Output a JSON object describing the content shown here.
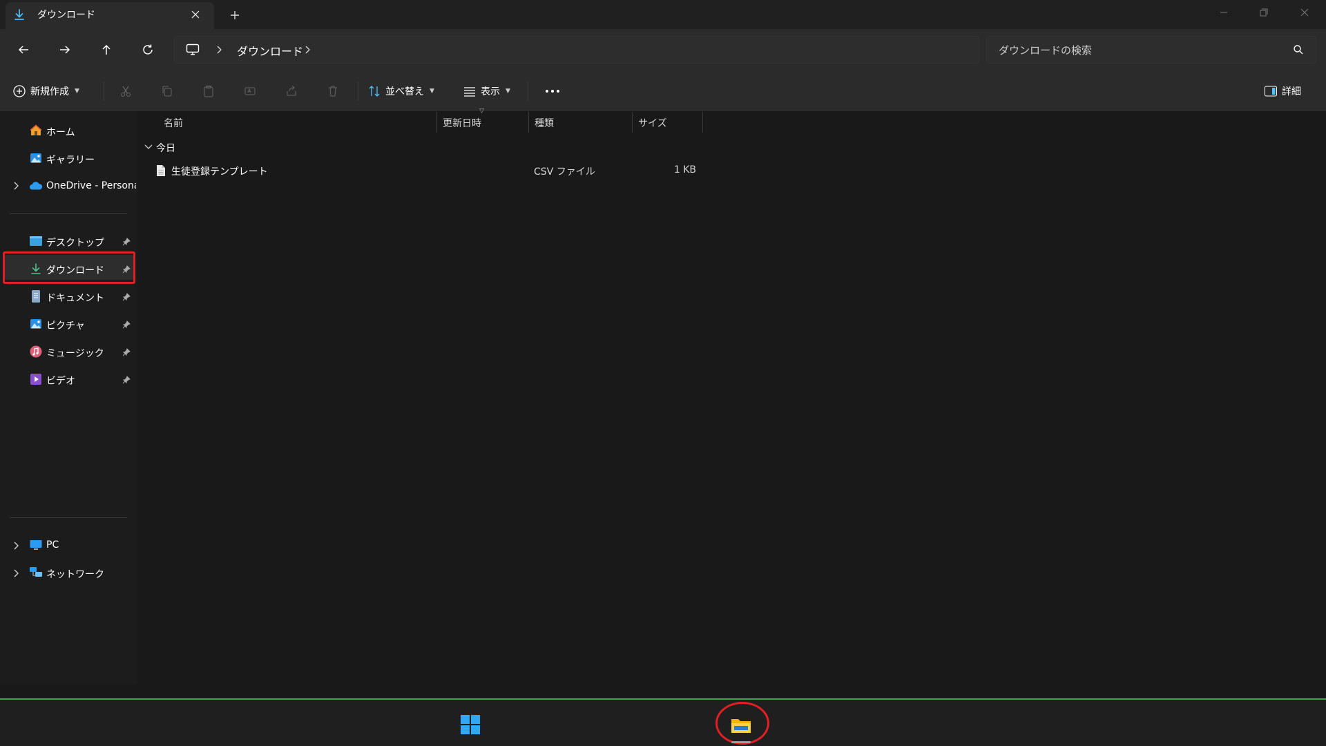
{
  "window": {
    "tab_title": "ダウンロード",
    "colors": {
      "accent": "#0078d4",
      "highlight": "#e21f24",
      "taskbar_line": "#3aa84a"
    }
  },
  "address": {
    "breadcrumb": [
      "ダウンロード"
    ],
    "search_placeholder": "ダウンロードの検索"
  },
  "toolbar": {
    "new_label": "新規作成",
    "sort_label": "並べ替え",
    "view_label": "表示",
    "details_label": "詳細"
  },
  "sidebar": {
    "top_items": [
      {
        "label": "ホーム",
        "icon": "home-icon"
      },
      {
        "label": "ギャラリー",
        "icon": "gallery-icon"
      },
      {
        "label": "OneDrive - Persona",
        "icon": "onedrive-icon"
      }
    ],
    "pinned_items": [
      {
        "label": "デスクトップ",
        "icon": "desktop-folder-icon"
      },
      {
        "label": "ダウンロード",
        "icon": "download-icon",
        "selected": true
      },
      {
        "label": "ドキュメント",
        "icon": "documents-icon"
      },
      {
        "label": "ピクチャ",
        "icon": "pictures-icon"
      },
      {
        "label": "ミュージック",
        "icon": "music-icon"
      },
      {
        "label": "ビデオ",
        "icon": "videos-icon"
      }
    ],
    "bottom_items": [
      {
        "label": "PC",
        "icon": "pc-icon"
      },
      {
        "label": "ネットワーク",
        "icon": "network-icon"
      }
    ]
  },
  "content": {
    "columns": [
      "名前",
      "更新日時",
      "種類",
      "サイズ"
    ],
    "group": "今日",
    "files": [
      {
        "name": "生徒登録テンプレート",
        "modified": "",
        "type": "CSV ファイル",
        "size": "1 KB"
      }
    ]
  },
  "taskbar": {
    "items": [
      "windows-start-icon",
      "file-explorer-icon"
    ]
  }
}
